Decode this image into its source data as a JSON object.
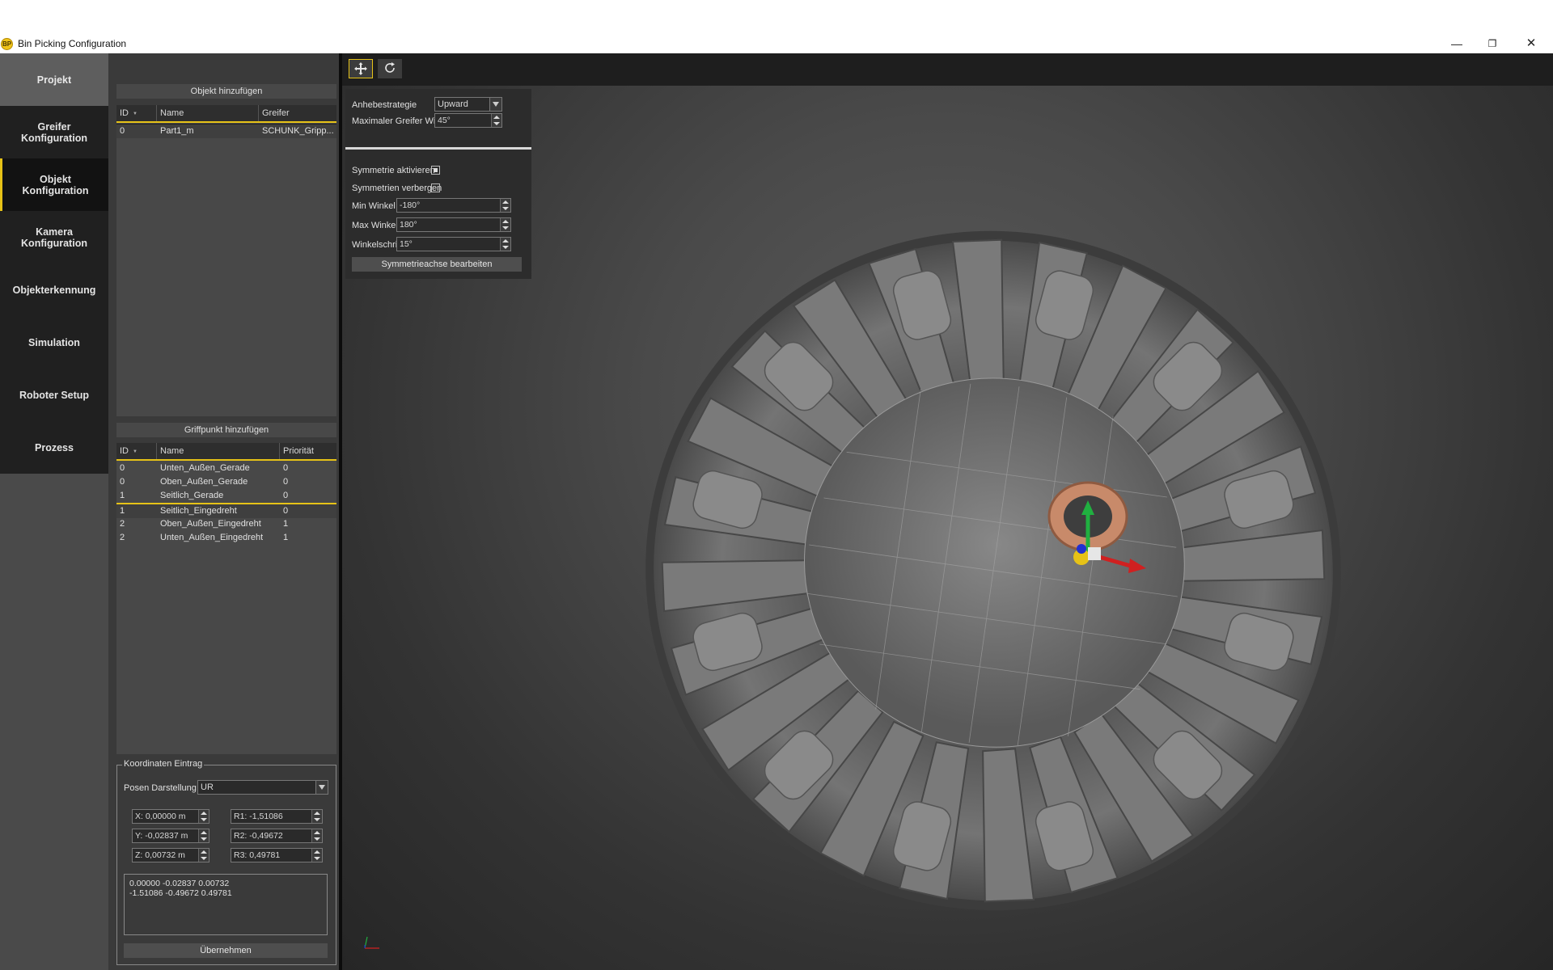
{
  "window": {
    "title": "Bin Picking Configuration",
    "minimize": "—",
    "maximize": "❐",
    "close": "✕"
  },
  "nav": [
    {
      "label": "Projekt"
    },
    {
      "label": "Greifer\nKonfiguration"
    },
    {
      "label": "Objekt\nKonfiguration"
    },
    {
      "label": "Kamera\nKonfiguration"
    },
    {
      "label": "Objekterkennung"
    },
    {
      "label": "Simulation"
    },
    {
      "label": "Roboter Setup"
    },
    {
      "label": "Prozess"
    }
  ],
  "objects": {
    "title": "Objekt hinzufügen",
    "headers": [
      "ID",
      "Name",
      "Greifer"
    ],
    "rows": [
      {
        "id": "0",
        "name": "Part1_m",
        "gripper": "SCHUNK_Gripp..."
      }
    ]
  },
  "grips": {
    "title": "Griffpunkt hinzufügen",
    "headers": [
      "ID",
      "Name",
      "Priorität"
    ],
    "rows": [
      {
        "id": "0",
        "name": "Unten_Außen_Gerade",
        "prio": "0"
      },
      {
        "id": "0",
        "name": "Oben_Außen_Gerade",
        "prio": "0"
      },
      {
        "id": "1",
        "name": "Seitlich_Gerade",
        "prio": "0"
      },
      {
        "id": "1",
        "name": "Seitlich_Eingedreht",
        "prio": "0"
      },
      {
        "id": "2",
        "name": "Oben_Außen_Eingedreht",
        "prio": "1"
      },
      {
        "id": "2",
        "name": "Unten_Außen_Eingedreht",
        "prio": "1"
      }
    ]
  },
  "coords": {
    "legend": "Koordinaten Eintrag",
    "pose_label": "Posen Darstellung",
    "pose_value": "UR",
    "x": "X: 0,00000 m",
    "y": "Y: -0,02837 m",
    "z": "Z: 0,00732 m",
    "r1": "R1: -1,51086",
    "r2": "R2: -0,49672",
    "r3": "R3: 0,49781",
    "text": "0.00000 -0.02837 0.00732\n-1.51086 -0.49672 0.49781",
    "apply_button": "Übernehmen"
  },
  "toolbar": {
    "move_icon": "move-icon",
    "rotate_icon": "rotate-icon"
  },
  "settings": {
    "lift_label": "Anhebestrategie",
    "lift_value": "Upward",
    "max_angle_label": "Maximaler Greifer Winkel",
    "max_angle_value": "45°",
    "sym_enable_label": "Symmetrie aktivieren",
    "sym_enable_checked": true,
    "sym_hide_label": "Symmetrien verbergen",
    "sym_hide_checked": false,
    "min_label": "Min Winkel",
    "min_value": "-180°",
    "max_label": "Max Winkel",
    "max_value": "180°",
    "step_label": "Winkelschritt",
    "step_value": "15°",
    "edit_axis_button": "Symmetrieachse bearbeiten"
  },
  "colors": {
    "accent": "#e6c217",
    "axis_x": "#d02020",
    "axis_y": "#20b040",
    "axis_z": "#2030d0",
    "part": "#c88a6a"
  }
}
